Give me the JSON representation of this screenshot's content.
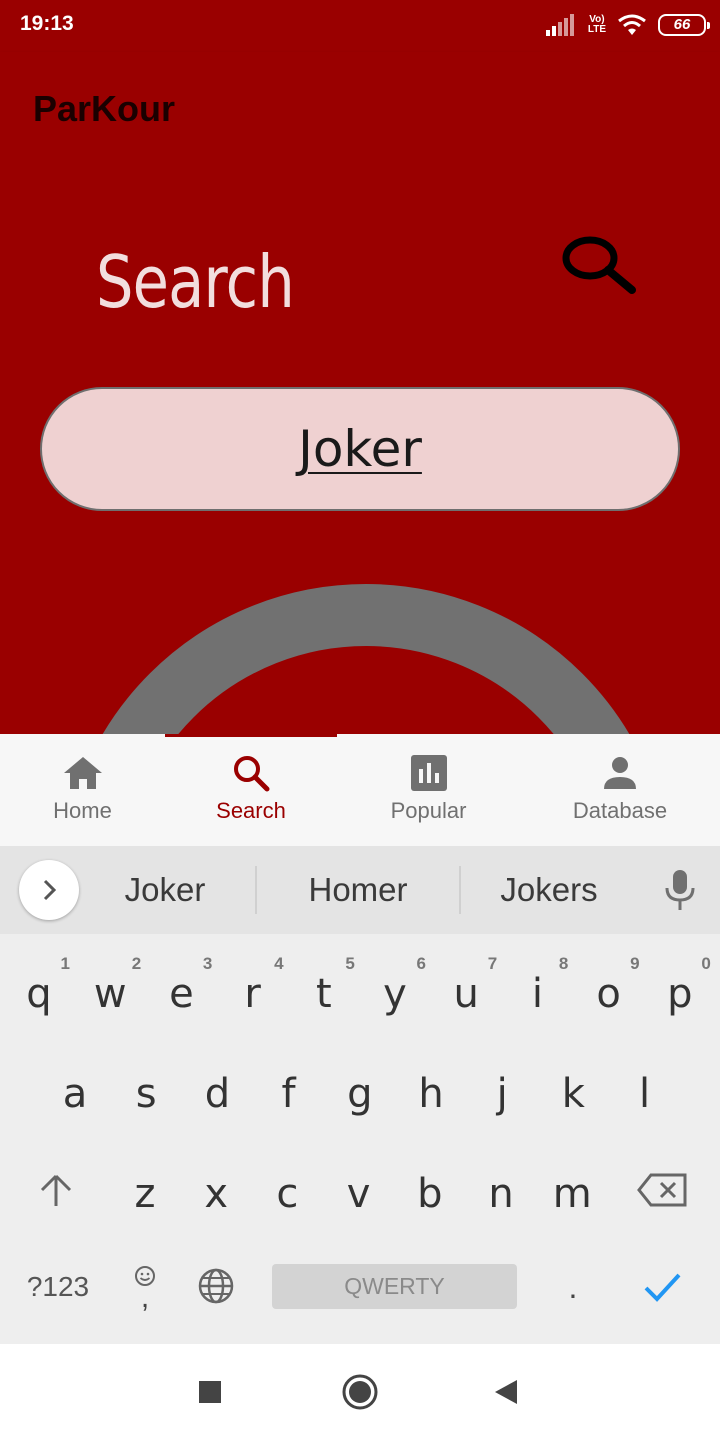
{
  "status_bar": {
    "time": "19:13",
    "volte_top": "Vo)",
    "volte_bottom": "LTE",
    "battery": "66"
  },
  "app_bar": {
    "title": "ParKour"
  },
  "main": {
    "heading": "Search",
    "query": "Joker"
  },
  "bottom_nav": {
    "items": [
      {
        "label": "Home",
        "icon": "home-icon"
      },
      {
        "label": "Search",
        "icon": "search-icon"
      },
      {
        "label": "Popular",
        "icon": "bar-chart-icon"
      },
      {
        "label": "Database",
        "icon": "person-icon"
      }
    ],
    "active": "Search"
  },
  "keyboard": {
    "suggestions": [
      "Joker",
      "Homer",
      "Jokers"
    ],
    "row1": [
      {
        "k": "q",
        "hint": "1"
      },
      {
        "k": "w",
        "hint": "2"
      },
      {
        "k": "e",
        "hint": "3"
      },
      {
        "k": "r",
        "hint": "4"
      },
      {
        "k": "t",
        "hint": "5"
      },
      {
        "k": "y",
        "hint": "6"
      },
      {
        "k": "u",
        "hint": "7"
      },
      {
        "k": "i",
        "hint": "8"
      },
      {
        "k": "o",
        "hint": "9"
      },
      {
        "k": "p",
        "hint": "0"
      }
    ],
    "row2": [
      "a",
      "s",
      "d",
      "f",
      "g",
      "h",
      "j",
      "k",
      "l"
    ],
    "row3": [
      "z",
      "x",
      "c",
      "v",
      "b",
      "n",
      "m"
    ],
    "symbols_label": "?123",
    "comma": ",",
    "space_label": "QWERTY",
    "period": "."
  },
  "colors": {
    "primary": "#9a0000",
    "field_bg": "#efd1d1",
    "accent_check": "#2196f3"
  }
}
